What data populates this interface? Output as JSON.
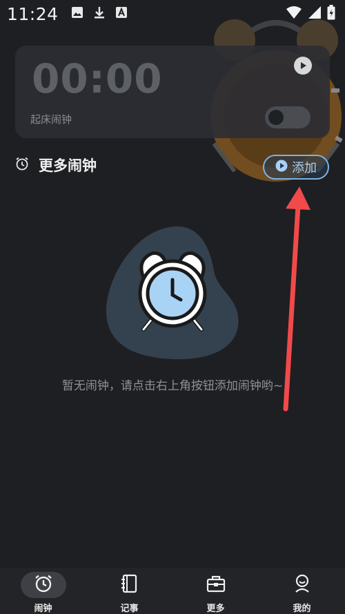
{
  "status_bar": {
    "time": "11:24",
    "left_icons": [
      "image-icon",
      "download-icon",
      "font-icon"
    ],
    "right_icons": [
      "wifi-icon",
      "signal-icon",
      "battery-icon"
    ]
  },
  "clock_card": {
    "time": "00:00",
    "label": "起床闹钟",
    "toggle_on": false
  },
  "section": {
    "title": "更多闹钟",
    "add_label": "添加"
  },
  "empty_state": {
    "message": "暂无闹钟，请点击右上角按钮添加闹钟哟~"
  },
  "bottom_nav": {
    "items": [
      {
        "label": "闹钟",
        "icon": "alarm-icon",
        "active": true
      },
      {
        "label": "记事",
        "icon": "notebook-icon",
        "active": false
      },
      {
        "label": "更多",
        "icon": "toolbox-icon",
        "active": false
      },
      {
        "label": "我的",
        "icon": "profile-icon",
        "active": false
      }
    ]
  },
  "colors": {
    "background": "#1e1f22",
    "card": "#2c2e33",
    "accent": "#7fb2e3",
    "arrow": "#f04a4a"
  }
}
